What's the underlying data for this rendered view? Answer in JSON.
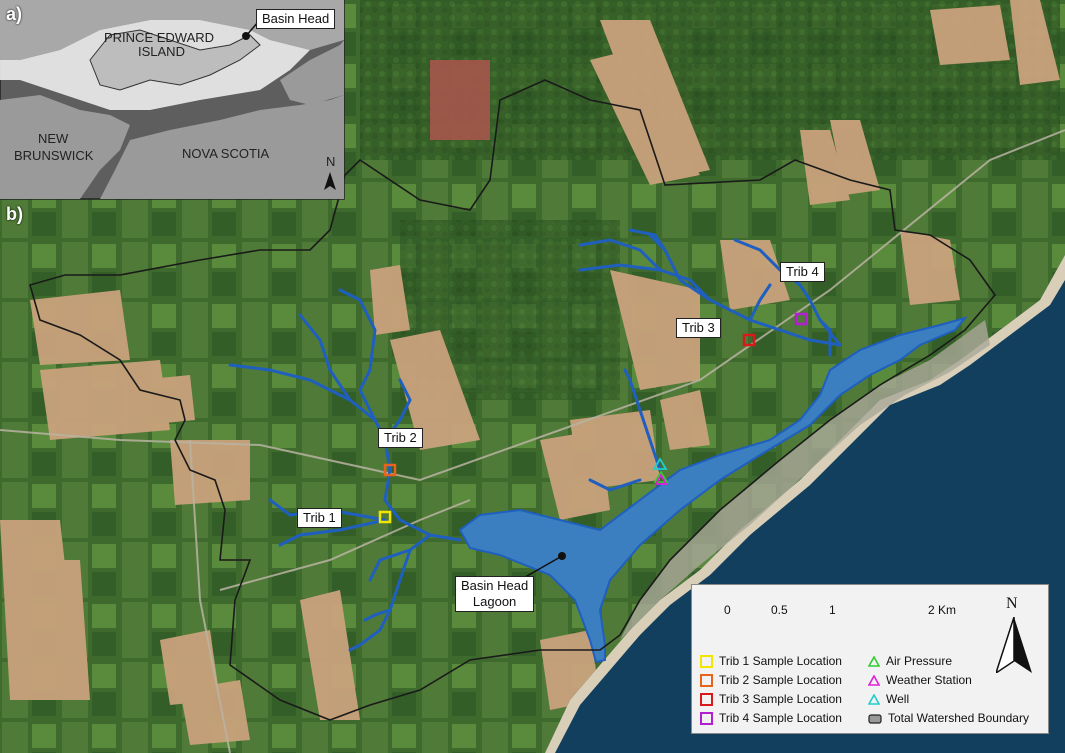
{
  "panels": {
    "a": "a)",
    "b": "b)"
  },
  "inset": {
    "labels": {
      "pei_line1": "PRINCE EDWARD",
      "pei_line2": "ISLAND",
      "nb_line1": "NEW",
      "nb_line2": "BRUNSWICK",
      "ns": "NOVA SCOTIA",
      "north": "N"
    },
    "callout": "Basin Head"
  },
  "map": {
    "callouts": {
      "trib1": "Trib 1",
      "trib2": "Trib 2",
      "trib3": "Trib 3",
      "trib4": "Trib 4",
      "lagoon_line1": "Basin Head",
      "lagoon_line2": "Lagoon"
    }
  },
  "legend": {
    "scale": {
      "ticks": [
        "0",
        "0.5",
        "1",
        "2 Km"
      ]
    },
    "north": "N",
    "items": [
      {
        "label": "Trib 1 Sample Location",
        "symbol": "square",
        "color": "#f2e600"
      },
      {
        "label": "Trib 2 Sample Location",
        "symbol": "square",
        "color": "#e8641e"
      },
      {
        "label": "Trib 3 Sample Location",
        "symbol": "square",
        "color": "#d81a1a"
      },
      {
        "label": "Trib 4 Sample Location",
        "symbol": "square",
        "color": "#b21fd0"
      },
      {
        "label": "Air Pressure",
        "symbol": "triangle",
        "color": "#33cc33"
      },
      {
        "label": "Weather Station",
        "symbol": "triangle",
        "color": "#e020d8"
      },
      {
        "label": "Well",
        "symbol": "triangle",
        "color": "#22cccc"
      },
      {
        "label": "Total Watershed Boundary",
        "symbol": "boundary",
        "color": "#222222"
      }
    ]
  },
  "colors": {
    "stream": "#1f5fbf",
    "lagoon": "#3a7fc0",
    "ocean": "#0e3a57",
    "field_light": "#c8a27a",
    "field_dark": "#3f6b2c"
  }
}
